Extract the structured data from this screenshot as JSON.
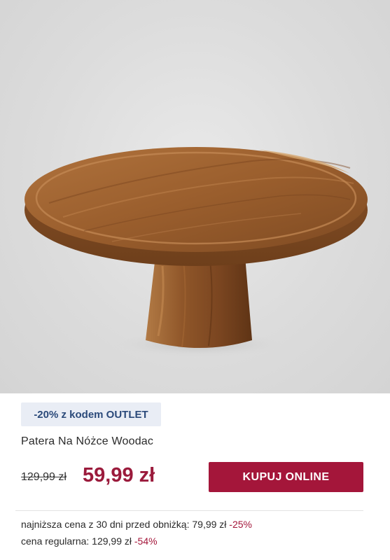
{
  "product": {
    "image_alt": "wooden-cake-stand",
    "promo_badge": "-20% z kodem OUTLET",
    "name": "Patera Na Nóżce Woodac",
    "old_price": "129,99 zł",
    "new_price": "59,99 zł",
    "buy_button": "KUPUJ ONLINE",
    "lowest_price_label": "najniższa cena z 30 dni przed obniżką: 79,99 zł",
    "lowest_price_pct": "-25%",
    "regular_price_label": "cena regularna: 129,99 zł",
    "regular_price_pct": "-54%"
  },
  "colors": {
    "accent": "#a4163a",
    "badge_bg": "#e9edf5",
    "badge_text": "#2b4a7a",
    "background": "#dcdcdc"
  }
}
